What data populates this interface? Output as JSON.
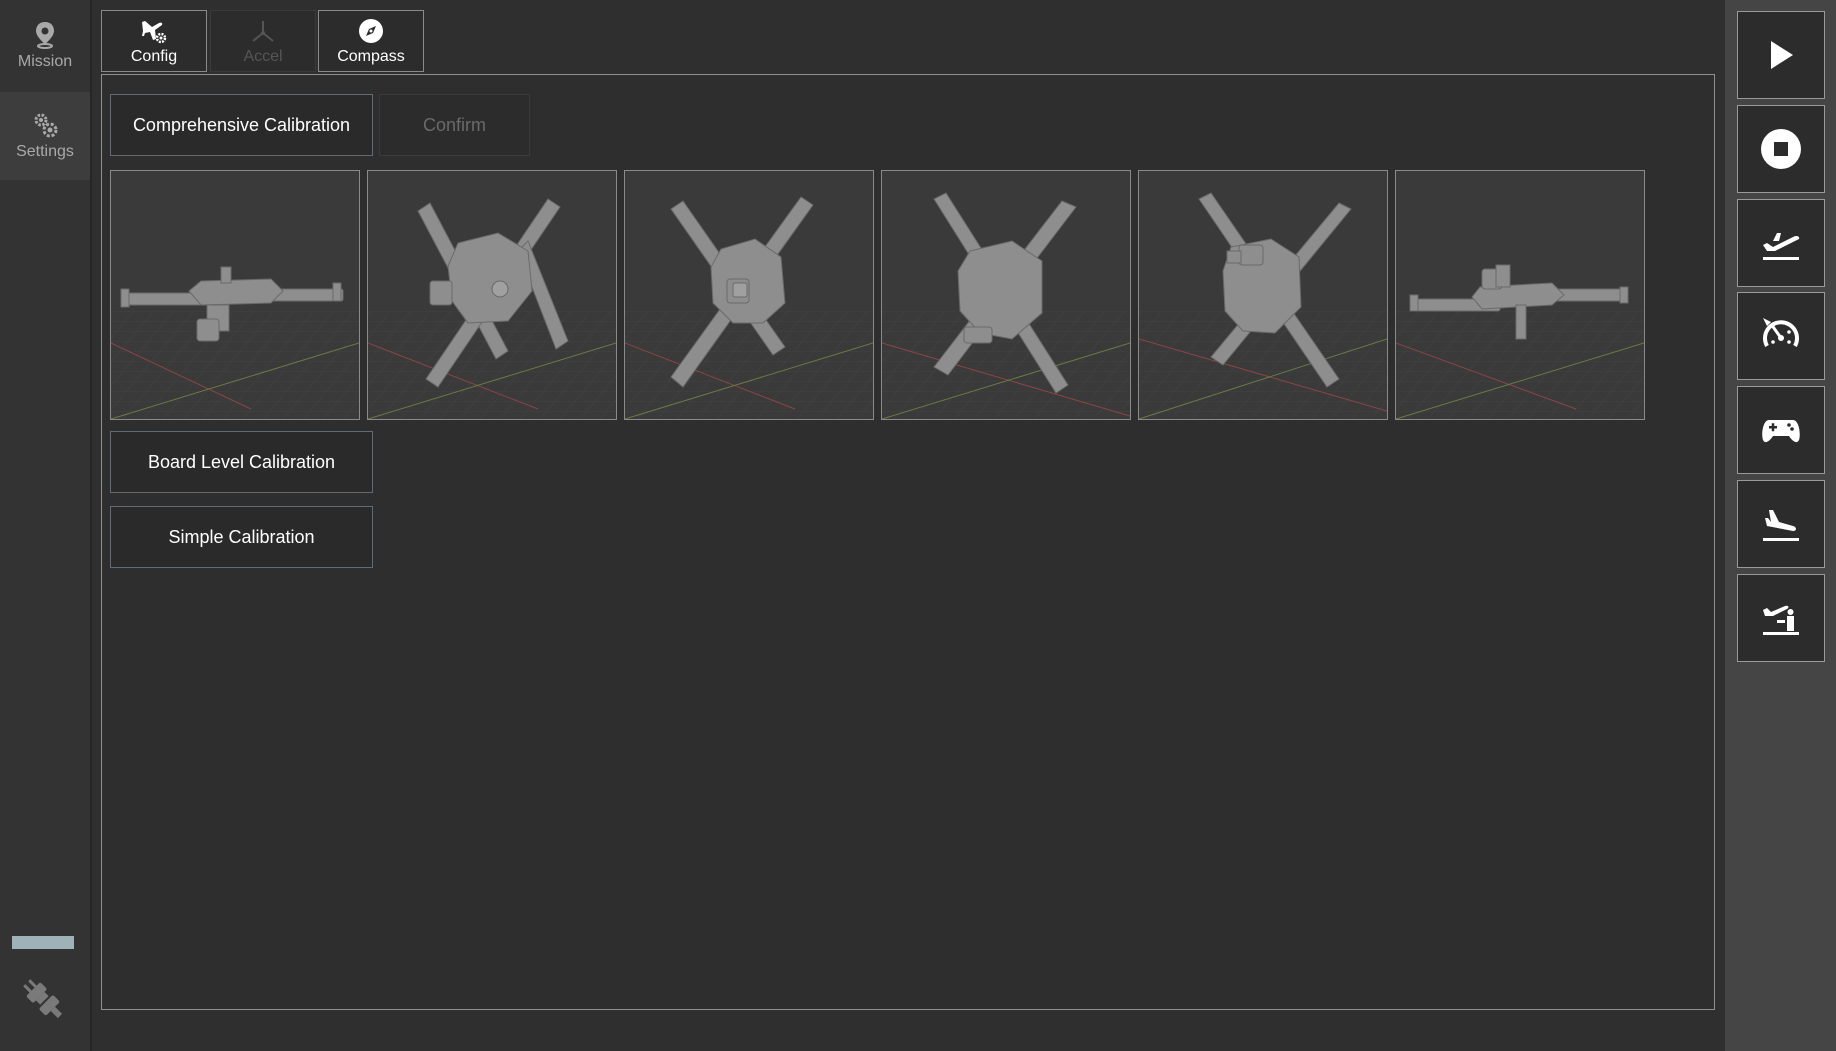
{
  "nav": {
    "mission_label": "Mission",
    "settings_label": "Settings",
    "link_progress": 1.0
  },
  "tabs": [
    {
      "label": "Config",
      "icon": "plane-gear-icon",
      "state": "normal"
    },
    {
      "label": "Accel",
      "icon": "axes-icon",
      "state": "disabled"
    },
    {
      "label": "Compass",
      "icon": "compass-icon",
      "state": "normal"
    }
  ],
  "calibration": {
    "comprehensive_label": "Comprehensive Calibration",
    "confirm_label": "Confirm",
    "board_level_label": "Board Level Calibration",
    "simple_label": "Simple Calibration",
    "orientations": [
      "level",
      "nose-down",
      "nose-up",
      "left-side",
      "right-side",
      "upside-down"
    ]
  },
  "toolbar": {
    "buttons": [
      "play-icon",
      "stop-icon",
      "takeoff-icon",
      "speedometer-icon",
      "gamepad-icon",
      "land-icon",
      "return-home-icon"
    ]
  },
  "colors": {
    "background": "#2f2f2f",
    "panel_border": "#8f8f8f",
    "button_border": "#5f6b75",
    "right_bar": "#454545"
  }
}
